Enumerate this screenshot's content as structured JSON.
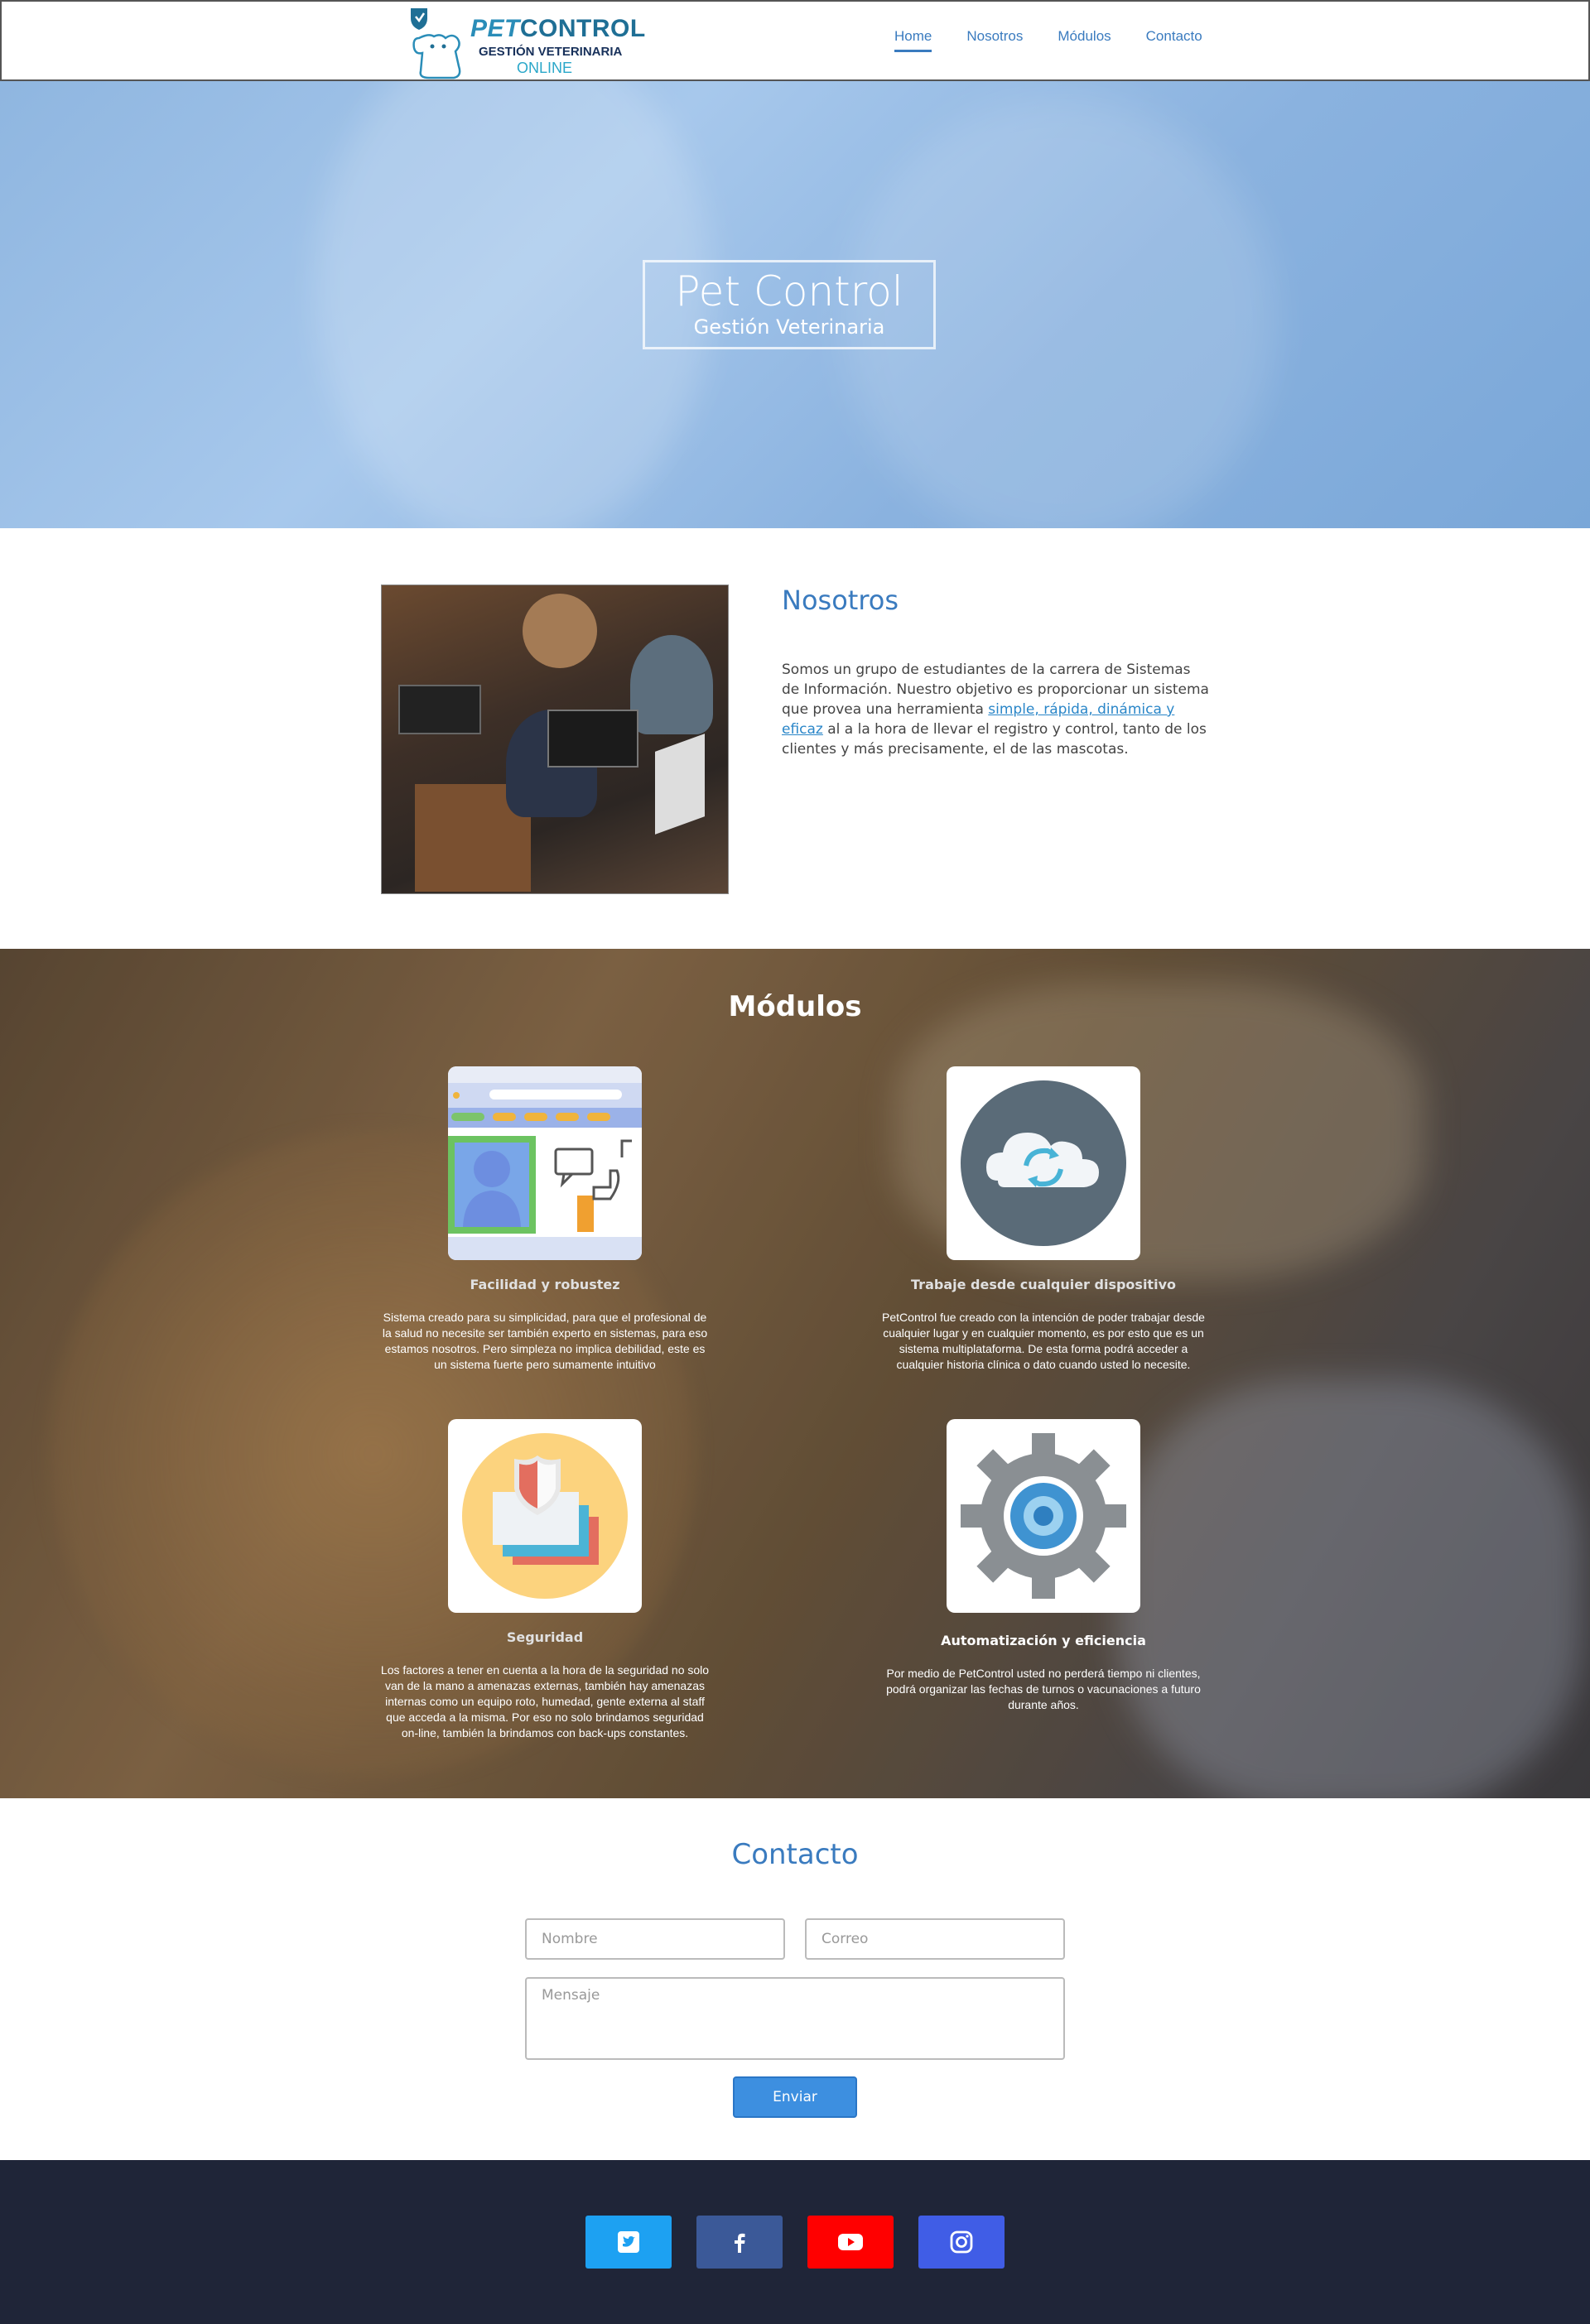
{
  "logo": {
    "word_pet": "PET",
    "word_control": "CONTROL",
    "tagline1": "GESTIÓN VETERINARIA",
    "tagline2": "ONLINE"
  },
  "nav": {
    "items": [
      {
        "label": "Home",
        "active": true
      },
      {
        "label": "Nosotros",
        "active": false
      },
      {
        "label": "Módulos",
        "active": false
      },
      {
        "label": "Contacto",
        "active": false
      }
    ]
  },
  "hero": {
    "title": "Pet Control",
    "subtitle": "Gestión Veterinaria"
  },
  "nosotros": {
    "title": "Nosotros",
    "text_before": "Somos un grupo de estudiantes de la carrera de Sistemas de Información. Nuestro objetivo es proporcionar un sistema que provea una herramienta ",
    "link": "simple, rápida, dinámica y eficaz",
    "text_after": " al a la hora de llevar el registro y control, tanto de los clientes y más precisamente, el de las mascotas."
  },
  "modulos": {
    "title": "Módulos",
    "cards": [
      {
        "icon": "profile-like-icon",
        "title": "Facilidad y robustez",
        "text": "Sistema creado para su simplicidad, para que el profesional de la salud no necesite ser también experto en sistemas, para eso estamos nosotros. Pero simpleza no implica debilidad, este es un sistema fuerte pero sumamente intuitivo"
      },
      {
        "icon": "cloud-sync-icon",
        "title": "Trabaje desde cualquier dispositivo",
        "text": "PetControl fue creado con la intención de poder trabajar desde cualquier lugar y en cualquier momento, es por esto que es un sistema multiplataforma. De esta forma podrá acceder a cualquier historia clínica o dato cuando usted lo necesite."
      },
      {
        "icon": "shield-security-icon",
        "title": "Seguridad",
        "text": "Los factores a tener en cuenta a la hora de la seguridad no solo van de la mano a amenazas externas, también hay amenazas internas como un equipo roto, humedad, gente externa al staff que acceda a la misma. Por eso no solo brindamos seguridad on-line, también la brindamos con back-ups constantes."
      },
      {
        "icon": "gear-icon",
        "title": "Automatización y eficiencia",
        "text": "Por medio de PetControl usted no perderá tiempo ni clientes, podrá organizar las fechas de turnos o vacunaciones a futuro durante años."
      }
    ]
  },
  "contacto": {
    "title": "Contacto",
    "name_placeholder": "Nombre",
    "email_placeholder": "Correo",
    "message_placeholder": "Mensaje",
    "send_label": "Enviar"
  },
  "footer": {
    "social": [
      {
        "icon": "twitter-icon",
        "color": "#1da1f2"
      },
      {
        "icon": "facebook-icon",
        "color": "#3b5998"
      },
      {
        "icon": "youtube-icon",
        "color": "#ff0000"
      },
      {
        "icon": "instagram-icon",
        "color": "#405de6"
      }
    ]
  }
}
